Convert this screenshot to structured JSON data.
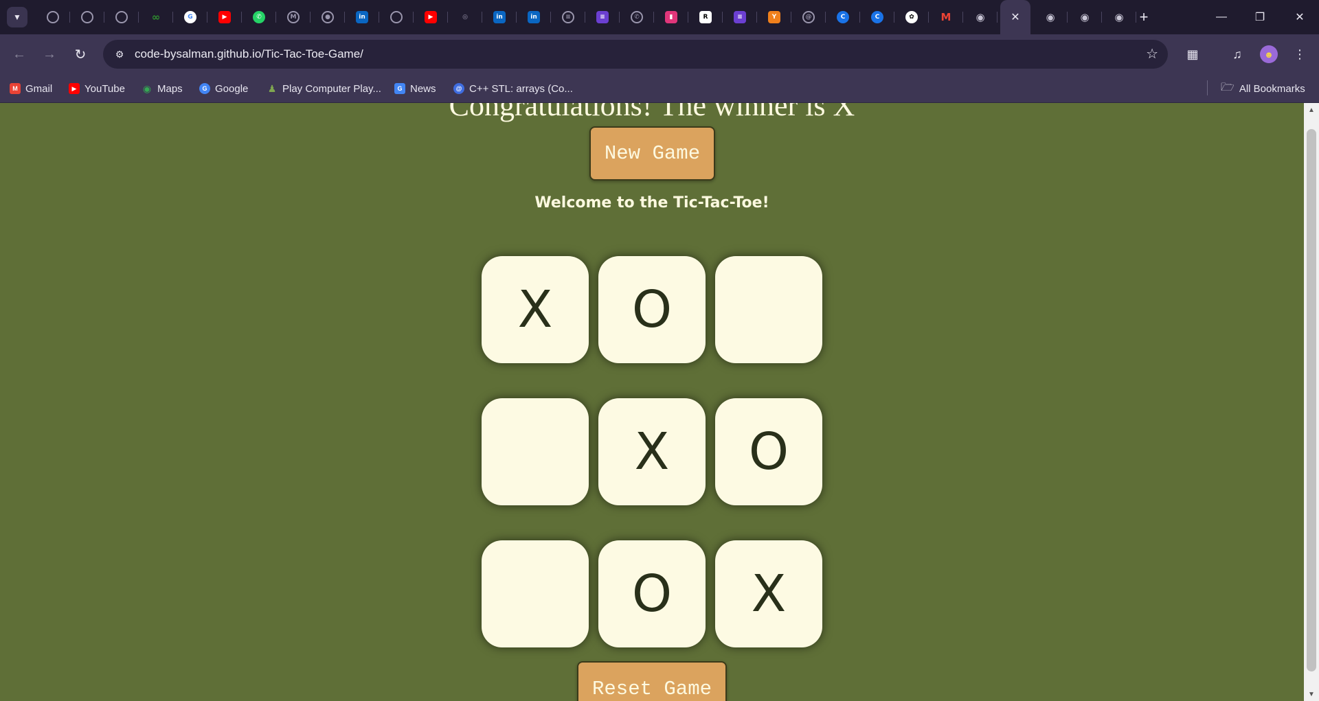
{
  "browser": {
    "tabs": [
      {
        "icon": "ring-icon",
        "color": "#9a96ad"
      },
      {
        "icon": "ring-icon",
        "color": "#9a96ad"
      },
      {
        "icon": "ring-icon",
        "color": "#9a96ad"
      },
      {
        "icon": "mask-icon",
        "color": "#2f8f2f"
      },
      {
        "icon": "google-icon",
        "color": "#ffffff"
      },
      {
        "icon": "youtube-icon",
        "color": "#ff0000"
      },
      {
        "icon": "whatsapp-icon",
        "color": "#25d366"
      },
      {
        "icon": "gmail-ring-icon",
        "color": "#9a96ad"
      },
      {
        "icon": "meet-ring-icon",
        "color": "#9a96ad"
      },
      {
        "icon": "linkedin-icon",
        "color": "#0a66c2"
      },
      {
        "icon": "ring-icon",
        "color": "#9a96ad"
      },
      {
        "icon": "youtube-icon",
        "color": "#ff0000"
      },
      {
        "icon": "target-icon",
        "color": "#9a96ad"
      },
      {
        "icon": "linkedin-icon",
        "color": "#0a66c2"
      },
      {
        "icon": "linkedin-icon",
        "color": "#0a66c2"
      },
      {
        "icon": "list-ring-icon",
        "color": "#9a96ad"
      },
      {
        "icon": "list-icon",
        "color": "#6b3fd1"
      },
      {
        "icon": "whatsapp-ring-icon",
        "color": "#9a96ad"
      },
      {
        "icon": "pink-doc-icon",
        "color": "#e0367a"
      },
      {
        "icon": "r-icon",
        "color": "#ffffff"
      },
      {
        "icon": "list-icon",
        "color": "#6b3fd1"
      },
      {
        "icon": "y-icon",
        "color": "#f0801c"
      },
      {
        "icon": "at-ring-icon",
        "color": "#9a96ad"
      },
      {
        "icon": "c-icon",
        "color": "#1a73e8"
      },
      {
        "icon": "c-icon",
        "color": "#1a73e8"
      },
      {
        "icon": "openai-icon",
        "color": "#ffffff"
      },
      {
        "icon": "gmail-icon",
        "color": "#ea4335"
      },
      {
        "icon": "globe-icon",
        "color": "#c9c6d6"
      },
      {
        "icon": "close-icon",
        "color": "#e8e6f0",
        "active": true
      },
      {
        "icon": "globe-icon",
        "color": "#c9c6d6"
      },
      {
        "icon": "chrome-icon",
        "color": "#c9c6d6"
      },
      {
        "icon": "chrome-icon",
        "color": "#c9c6d6"
      }
    ],
    "url": "code-bysalman.github.io/Tic-Tac-Toe-Game/",
    "bookmarks": [
      {
        "label": "Gmail",
        "icon": "gmail-icon",
        "color": "#ea4335"
      },
      {
        "label": "YouTube",
        "icon": "youtube-icon",
        "color": "#ff0000"
      },
      {
        "label": "Maps",
        "icon": "maps-icon",
        "color": "#34a853"
      },
      {
        "label": "Google",
        "icon": "google-icon",
        "color": "#4285f4"
      },
      {
        "label": "Play Computer Play...",
        "icon": "chess-pawn-icon",
        "color": "#7fa650"
      },
      {
        "label": "News",
        "icon": "news-icon",
        "color": "#4285f4"
      },
      {
        "label": "C++ STL: arrays (Co...",
        "icon": "at-icon",
        "color": "#3f6de0"
      }
    ],
    "all_bookmarks_label": "All Bookmarks"
  },
  "game": {
    "winner_text": "Congratulations! The winner is X",
    "new_game_label": "New Game",
    "welcome_text": "Welcome to the Tic-Tac-Toe!",
    "board": [
      "X",
      "O",
      "",
      "",
      "X",
      "O",
      "",
      "O",
      "X"
    ],
    "reset_label": "Reset Game"
  },
  "colors": {
    "page_background": "#5f6f37",
    "cell_background": "#fdfae3",
    "button_background": "#dba35e",
    "text_light": "#fdf9e0"
  }
}
